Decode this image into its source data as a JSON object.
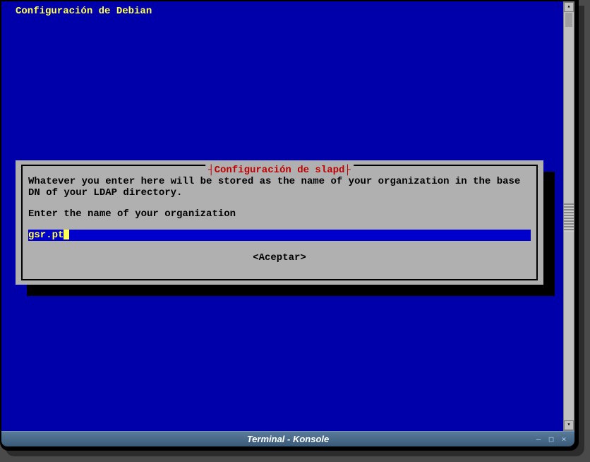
{
  "header": {
    "title": "Configuración de Debian"
  },
  "dialog": {
    "title": "Configuración de slapd",
    "description": "Whatever you enter here will be stored as the name of your organization in the base DN of your LDAP directory.",
    "prompt": "Enter the name of your organization",
    "input_value": "gsr.pt",
    "accept_label": "<Aceptar>"
  },
  "titlebar": {
    "text": "Terminal - Konsole"
  },
  "window_controls": {
    "minimize": "–",
    "maximize": "□",
    "close": "×"
  }
}
